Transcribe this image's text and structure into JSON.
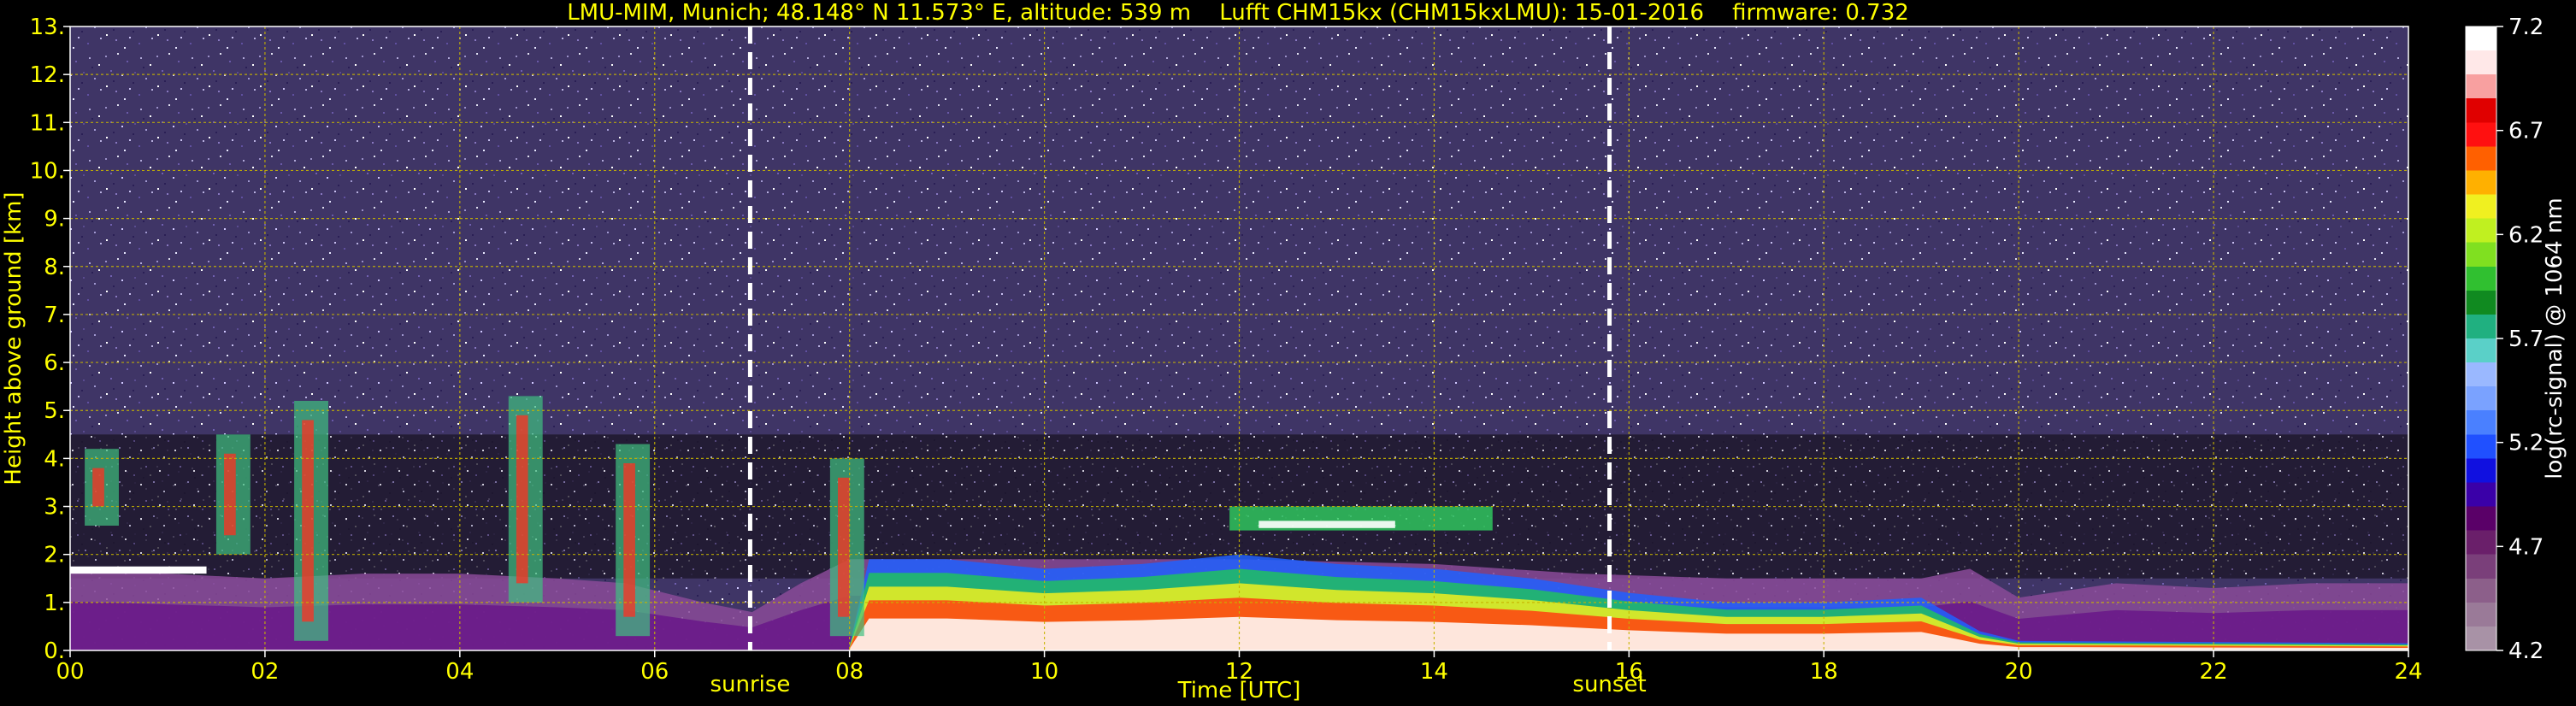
{
  "chart_data": {
    "type": "heatmap",
    "title": "LMU-MIM, Munich; 48.148° N 11.573° E, altitude: 539 m    Lufft CHM15kx (CHM15kxLMU): 15-01-2016    firmware: 0.732",
    "xlabel": "Time [UTC]",
    "ylabel": "Height above ground [km]",
    "xlim": [
      0,
      24
    ],
    "ylim": [
      0,
      13
    ],
    "x_ticks": [
      0,
      2,
      4,
      6,
      8,
      10,
      12,
      14,
      16,
      18,
      20,
      22,
      24
    ],
    "x_tick_labels": [
      "00",
      "02",
      "04",
      "06",
      "08",
      "10",
      "12",
      "14",
      "16",
      "18",
      "20",
      "22",
      "24"
    ],
    "y_ticks": [
      0,
      1,
      2,
      3,
      4,
      5,
      6,
      7,
      8,
      9,
      10,
      11,
      12,
      13
    ],
    "y_tick_labels": [
      "0.",
      "1.",
      "2.",
      "3.",
      "4.",
      "5.",
      "6.",
      "7.",
      "8.",
      "9.",
      "10.",
      "11.",
      "12.",
      "13."
    ],
    "grid": true,
    "events": [
      {
        "label": "sunrise",
        "x": 6.98
      },
      {
        "label": "sunset",
        "x": 15.8
      }
    ],
    "colorbar": {
      "label": "log(rc-signal) @ 1064 nm",
      "min": 4.2,
      "max": 7.2,
      "tick_values": [
        4.2,
        4.7,
        5.2,
        5.7,
        6.2,
        6.7,
        7.2
      ],
      "tick_labels": [
        "4.2",
        "4.7",
        "5.2",
        "5.7",
        "6.2",
        "6.7",
        "7.2"
      ],
      "colors": [
        "#a892a6",
        "#9a7a98",
        "#8c5f8a",
        "#7a3f7a",
        "#6a1f6a",
        "#5a0068",
        "#3a00a8",
        "#1010e0",
        "#2050ff",
        "#4a80ff",
        "#7aa2ff",
        "#9ab8ff",
        "#5ad0c8",
        "#20b080",
        "#108a20",
        "#30c030",
        "#80e020",
        "#c0f020",
        "#f0f020",
        "#ffb000",
        "#ff6000",
        "#ff1010",
        "#e00000",
        "#f8a0a0",
        "#ffe8e8",
        "#ffffff"
      ]
    },
    "background_noise_color": "#4a3c6e"
  }
}
